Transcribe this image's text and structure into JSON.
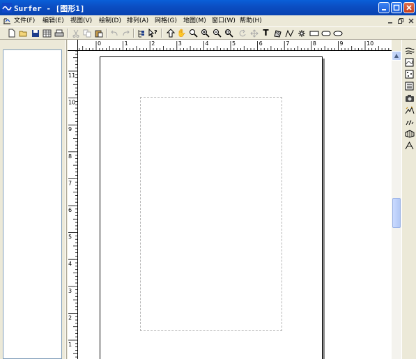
{
  "window": {
    "title": "Surfer - [图形1]"
  },
  "menu": {
    "items": [
      "文件(F)",
      "编辑(E)",
      "视图(V)",
      "绘制(D)",
      "排列(A)",
      "网格(G)",
      "地图(M)",
      "窗口(W)",
      "帮助(H)"
    ]
  },
  "ruler": {
    "horizontal_labels": [
      "0",
      "1",
      "2",
      "3",
      "4",
      "5",
      "6",
      "7",
      "8",
      "9",
      "10",
      "11"
    ],
    "vertical_labels": [
      "11",
      "10",
      "9",
      "8",
      "7",
      "6",
      "5",
      "4",
      "3",
      "2",
      "1"
    ]
  },
  "toolbar": {
    "icons": [
      "new-icon",
      "open-icon",
      "save-icon",
      "worksheet-icon",
      "print-icon",
      "cut-icon",
      "copy-icon",
      "paste-icon",
      "undo-icon",
      "redo-icon",
      "object-manager-icon",
      "help-pointer-icon",
      "select-icon",
      "pan-icon",
      "zoom-rect-icon",
      "zoom-in-icon",
      "zoom-out-icon",
      "zoom-page-icon",
      "rotate-icon",
      "move-icon",
      "text-icon",
      "polygon-icon",
      "polyline-icon",
      "symbol-icon",
      "rectangle-icon",
      "rounded-rect-icon",
      "ellipse-icon"
    ]
  },
  "map_toolbar": {
    "icons": [
      "contour-map-icon",
      "base-map-icon",
      "post-map-icon",
      "classed-post-icon",
      "image-map-icon",
      "shaded-relief-icon",
      "vector-map-icon",
      "wireframe-icon",
      "surface-icon"
    ]
  }
}
